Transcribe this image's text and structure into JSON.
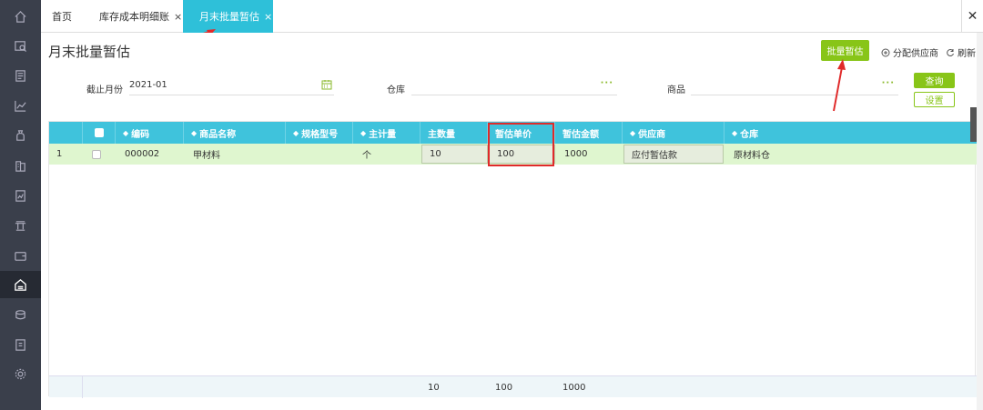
{
  "sidebar": {
    "icons": [
      "home-icon",
      "search-doc-icon",
      "document-icon",
      "chart-icon",
      "money-bag-icon",
      "ledger-icon",
      "report-icon",
      "bank-icon",
      "wallet-icon",
      "warehouse-icon",
      "coins-icon",
      "invoice-icon",
      "settings-icon"
    ],
    "active_index": 9
  },
  "tabs": [
    {
      "label": "首页",
      "closable": false
    },
    {
      "label": "库存成本明细账",
      "closable": true
    },
    {
      "label": "月末批量暂估",
      "closable": true,
      "active": true
    }
  ],
  "close_symbol": "×",
  "close_all_symbol": "✕",
  "page": {
    "title": "月末批量暂估",
    "batch_button": "批量暂估",
    "assign_supplier": "分配供应商",
    "refresh": "刷新"
  },
  "filters": {
    "cutoff_label": "截止月份",
    "cutoff_value": "2021-01",
    "warehouse_label": "仓库",
    "warehouse_value": "",
    "goods_label": "商品",
    "goods_value": "",
    "picker_dots": "···",
    "query_button": "查询",
    "settings_button": "设置"
  },
  "grid": {
    "columns": [
      {
        "label": "",
        "sortable": false,
        "checkbox": true
      },
      {
        "label": "编码",
        "sortable": true
      },
      {
        "label": "商品名称",
        "sortable": true
      },
      {
        "label": "规格型号",
        "sortable": true
      },
      {
        "label": "主计量",
        "sortable": true
      },
      {
        "label": "主数量",
        "sortable": false
      },
      {
        "label": "暂估单价",
        "sortable": false
      },
      {
        "label": "暂估金额",
        "sortable": false
      },
      {
        "label": "供应商",
        "sortable": true
      },
      {
        "label": "仓库",
        "sortable": true
      }
    ],
    "sort_glyph": "◆",
    "rows": [
      {
        "index": "1",
        "code": "000002",
        "name": "甲材料",
        "spec": "",
        "unit": "个",
        "qty": "10",
        "unit_price": "100",
        "amount": "1000",
        "supplier": "应付暂估款",
        "warehouse": "原材料仓"
      }
    ],
    "footer": {
      "qty": "10",
      "unit_price": "100",
      "amount": "1000"
    }
  },
  "colors": {
    "accent": "#2ec0d9",
    "header": "#3fc3dc",
    "green": "#88c518",
    "row_highlight": "#dff6cf",
    "sidebar": "#3a3f4b",
    "annotation_red": "#e02a2a"
  }
}
